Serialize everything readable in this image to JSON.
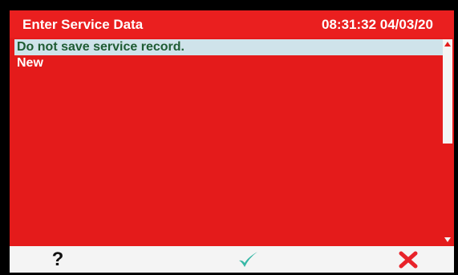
{
  "title_bar": {
    "title": "Enter Service Data",
    "datetime": "08:31:32 04/03/20"
  },
  "list": {
    "items": [
      {
        "label": "Do not save service record.",
        "selected": true
      },
      {
        "label": "New",
        "selected": false
      }
    ]
  },
  "bottom_bar": {
    "help_label": "?",
    "ok_icon": "checkmark-icon",
    "cancel_icon": "x-icon"
  },
  "colors": {
    "background_red": "#e41b1b",
    "selection_bg": "#cfe3ea",
    "selection_text": "#1f5c33",
    "ok_teal": "#36b8a6",
    "cancel_red": "#e8232a"
  }
}
